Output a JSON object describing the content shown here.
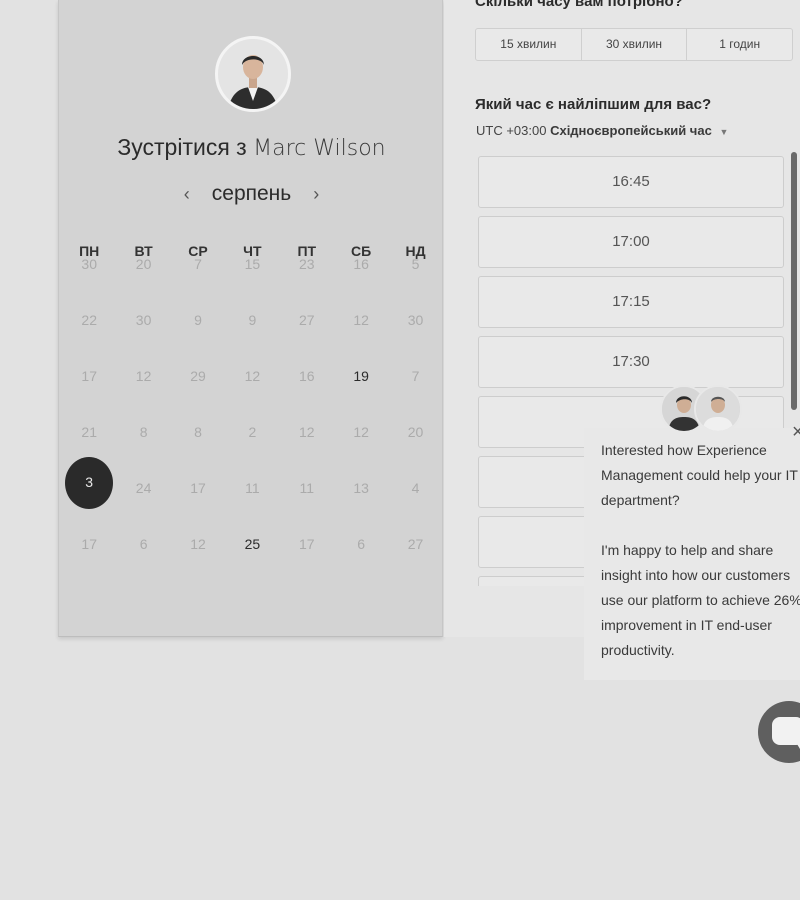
{
  "calendar": {
    "title_prefix": "Зустрітися з",
    "host_name": "Marc Wilson",
    "month": "серпень",
    "prev_arrow": "‹",
    "next_arrow": "›",
    "weekdays": [
      "ПН",
      "ВТ",
      "СР",
      "ЧТ",
      "ПТ",
      "СБ",
      "НД"
    ],
    "weeks": [
      [
        "30",
        "20",
        "7",
        "15",
        "23",
        "16",
        "5"
      ],
      [
        "22",
        "30",
        "9",
        "9",
        "27",
        "12",
        "30"
      ],
      [
        "17",
        "12",
        "29",
        "12",
        "16",
        "19",
        "7"
      ],
      [
        "21",
        "8",
        "8",
        "2",
        "12",
        "12",
        "20"
      ],
      [
        "3",
        "24",
        "17",
        "11",
        "11",
        "13",
        "4"
      ],
      [
        "17",
        "6",
        "12",
        "25",
        "17",
        "6",
        "27"
      ]
    ],
    "selected_day": "3",
    "available_days": [
      "19",
      "25"
    ]
  },
  "scheduler": {
    "duration_question": "Скільки часу вам потрібно?",
    "durations": [
      "15 хвилин",
      "30 хвилин",
      "1 годин"
    ],
    "time_question": "Який час є найліпшим для вас?",
    "timezone_offset": "UTC +03:00",
    "timezone_name": "Східноєвропейський час",
    "time_slots": [
      "16:45",
      "17:00",
      "17:15",
      "17:30",
      "",
      "",
      "",
      ""
    ]
  },
  "chat": {
    "message_1": "Interested how Experience Management could help your IT department?",
    "message_2": "I'm happy to help and share insight into how our customers use our platform to achieve 26% improvement in IT end-user productivity.",
    "close": "×"
  }
}
